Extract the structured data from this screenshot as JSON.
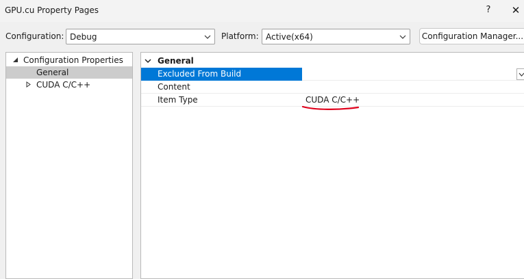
{
  "window": {
    "title": "GPU.cu Property Pages",
    "help_label": "?",
    "close_label": "✕"
  },
  "toolbar": {
    "configuration_label": "Configuration:",
    "configuration_value": "Debug",
    "platform_label": "Platform:",
    "platform_value": "Active(x64)",
    "config_manager_label": "Configuration Manager..."
  },
  "tree": {
    "items": [
      {
        "label": "Configuration Properties",
        "expanded": true,
        "selected": false
      },
      {
        "label": "General",
        "selected": true
      },
      {
        "label": "CUDA C/C++",
        "expanded": false,
        "selected": false
      }
    ]
  },
  "grid": {
    "category": "General",
    "properties": [
      {
        "name": "Excluded From Build",
        "value": "",
        "selected": true
      },
      {
        "name": "Content",
        "value": ""
      },
      {
        "name": "Item Type",
        "value": "CUDA C/C++"
      }
    ]
  },
  "colors": {
    "selection_blue": "#0078d7",
    "annotation_red": "#e0001b"
  }
}
